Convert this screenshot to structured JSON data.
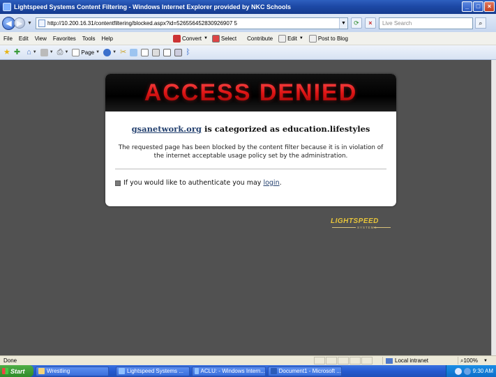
{
  "window": {
    "title": "Lightspeed Systems Content Filtering - Windows Internet Explorer provided by NKC Schools",
    "buttons": {
      "minimize": "_",
      "maximize": "□",
      "close": "×"
    }
  },
  "address_bar": {
    "url": "http://10.200.16.31/contentfiltering/blocked.aspx?id=526556452830926907 5",
    "search_placeholder": "Live Search"
  },
  "menu": {
    "items": [
      "File",
      "Edit",
      "View",
      "Favorites",
      "Tools",
      "Help"
    ],
    "toolbar": {
      "convert": "Convert",
      "select": "Select",
      "contribute": "Contribute",
      "edit": "Edit",
      "post_to_blog": "Post to Blog"
    }
  },
  "command_bar": {
    "page": "Page"
  },
  "page": {
    "headline": "ACCESS DENIED",
    "category_site": "gsanetwork.org",
    "category_text": "is categorized as education.lifestyles",
    "message": "The requested page has been blocked by the content filter because it is in violation of the internet acceptable usage policy set by the administration.",
    "auth_text": "If you would like to authenticate you may",
    "auth_link": "login",
    "auth_suffix": ".",
    "logo_text": "LIGHTSPEED",
    "logo_sub": "SYSTEMS"
  },
  "status_bar": {
    "status": "Done",
    "zone": "Local intranet",
    "zoom": "100%"
  },
  "taskbar": {
    "start": "Start",
    "tasks": [
      {
        "label": "Wrestling"
      },
      {
        "label": "Lightspeed Systems ..."
      },
      {
        "label": "ACLU: - Windows Intern..."
      },
      {
        "label": "Document1 - Microsoft ..."
      }
    ],
    "clock": "9:30 AM"
  }
}
